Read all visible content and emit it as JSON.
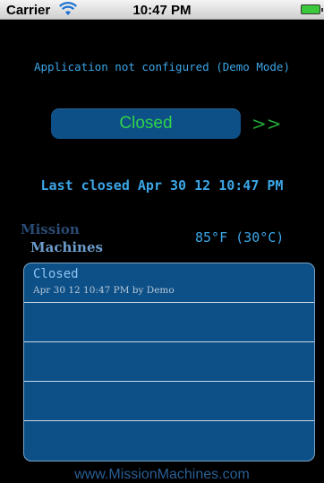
{
  "statusbar": {
    "carrier": "Carrier",
    "time": "10:47 PM"
  },
  "config_message": "Application not configured (Demo Mode)",
  "door": {
    "state": "Closed",
    "arrows": ">>"
  },
  "last_closed": "Last closed Apr 30 12 10:47 PM",
  "logo": {
    "line1": "Mission",
    "line2": "Machines"
  },
  "temperature": "85°F (30°C)",
  "log": [
    {
      "title": "Closed",
      "subtitle": "Apr 30 12 10:47 PM by Demo"
    },
    {
      "title": "",
      "subtitle": ""
    },
    {
      "title": "",
      "subtitle": ""
    },
    {
      "title": "",
      "subtitle": ""
    },
    {
      "title": "",
      "subtitle": ""
    }
  ],
  "footer": "www.MissionMachines.com",
  "colors": {
    "accent": "#3ba6e6",
    "status_green": "#2fd24a",
    "panel": "#0d4f87"
  }
}
